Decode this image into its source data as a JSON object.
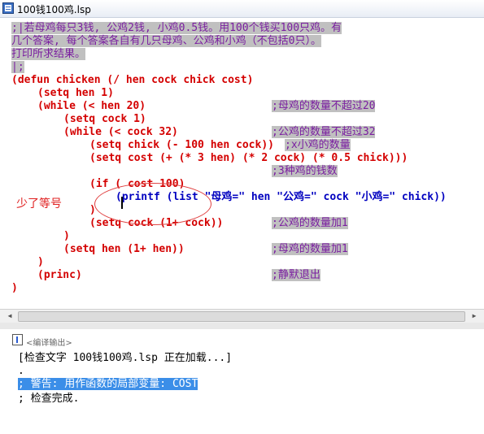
{
  "window": {
    "title": "100钱100鸡.lsp"
  },
  "code": {
    "comment1": ";|若母鸡每只3钱, 公鸡2钱, 小鸡0.5钱。用100个钱买100只鸡。有",
    "comment2": "几个答案, 每个答案各自有几只母鸡、公鸡和小鸡（不包括0只）。",
    "comment3": "打印所求结果。",
    "comment4": "|;",
    "defun": "(defun chicken (/ hen cock chick cost)",
    "setq_hen": "(setq hen 1)",
    "while_hen": "(while (< hen 20)",
    "setq_cock": "(setq cock 1)",
    "while_cock": "(while (< cock 32)",
    "setq_chick": "(setq chick (- 100 hen cock))",
    "setq_cost": "(setq cost (+ (* 3 hen) (* 2 cock) (* 0.5 chick)))",
    "if_line": "(if ( cost 100)",
    "printf_line": "(printf (list \"母鸡=\" hen \"公鸡=\" cock \"小鸡=\" chick))",
    "close_if": ")",
    "incr_cock": "(setq cock (1+ cock))",
    "close_cock": ")",
    "incr_hen": "(setq hen (1+ hen))",
    "close_hen": ")",
    "princ": "(princ)",
    "close_defun": ")",
    "c_hen_limit": ";母鸡的数量不超过20",
    "c_cock_limit": ";公鸡的数量不超过32",
    "c_chick_count": ";x小鸡的数量",
    "c_cost": ";3种鸡的钱数",
    "c_cock_incr": ";公鸡的数量加1",
    "c_hen_incr": ";母鸡的数量加1",
    "c_quiet": ";静默退出"
  },
  "annotation": {
    "text": "少了等号"
  },
  "output": {
    "title": "<编译输出>",
    "lines": [
      "[检查文字 100钱100鸡.lsp 正在加载...]",
      ".",
      "; 警告: 用作函数的局部变量: COST",
      "; 检查完成."
    ]
  },
  "colors": {
    "keyword": "#d40000",
    "symbol": "#0000c0",
    "number": "#007a00",
    "comment_bg": "#c0c0c0",
    "selection": "#3b8ee8"
  }
}
